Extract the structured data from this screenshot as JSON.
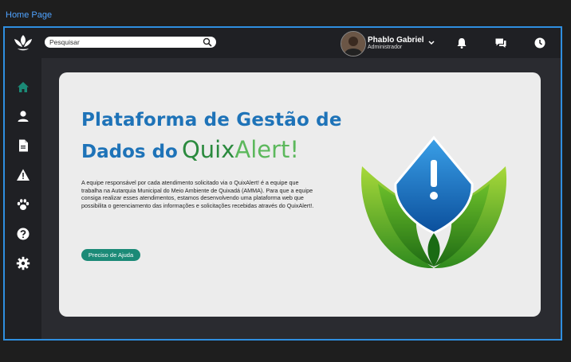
{
  "frame": {
    "label": "Home Page"
  },
  "topbar": {
    "search_placeholder": "Pesquisar",
    "user": {
      "name": "Phablo Gabriel",
      "role": "Administrador"
    },
    "icons": [
      "bell-icon",
      "chat-icon",
      "clock-icon"
    ]
  },
  "sidebar": {
    "items": [
      {
        "name": "home",
        "icon": "home-icon",
        "active": true
      },
      {
        "name": "profile",
        "icon": "user-icon"
      },
      {
        "name": "documents",
        "icon": "document-icon"
      },
      {
        "name": "alerts",
        "icon": "warning-icon"
      },
      {
        "name": "animals",
        "icon": "paw-icon"
      },
      {
        "name": "help",
        "icon": "help-icon"
      },
      {
        "name": "settings",
        "icon": "gear-icon"
      }
    ]
  },
  "hero": {
    "title_line1": "Plataforma de Gestão de",
    "title_line2_prefix": "Dados do",
    "brand_part1": "Quix",
    "brand_part2": "Alert!",
    "description": "A equipe responsável por cada atendimento solicitado via o QuixAlert! é a equipe que trabalha na Autarquia Municipal do Meio Ambiente de Quixadá (AMMA). Para que a equipe consiga realizar esses atendimentos, estamos desenvolvendo uma plataforma web que possibilita o gerenciamento das informações e solicitações recebidas através do QuixAlert!.",
    "button_label": "Preciso de Ajuda"
  },
  "colors": {
    "accent_blue": "#1e73b8",
    "brand_green": "#2b8a3e",
    "button_teal": "#1b8a77",
    "active_icon": "#1b8a77"
  }
}
